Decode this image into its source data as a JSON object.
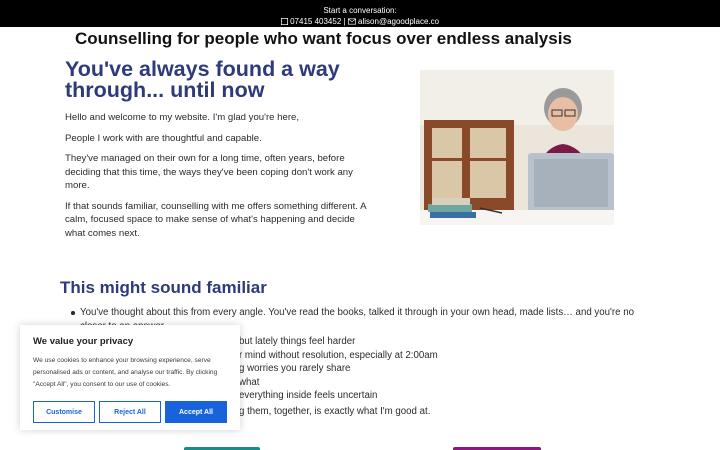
{
  "topbar": {
    "title": "Start a conversation:",
    "phone": "07415 403452",
    "separator": " | ",
    "email": "alison@agoodplace.co"
  },
  "tagline": "Counselling for people who want focus over endless analysis",
  "hero": {
    "title": "You've always found a way through... until now",
    "paragraphs": [
      "Hello and welcome to my website. I'm glad you're here,",
      "People I work with are thoughtful and capable.",
      "They've managed on their own for a long time, often years, before deciding that this time, the ways they've been coping don't work any more.",
      "If that sounds familiar, counselling with me offers something different. A calm, focused space to make sense of what's happening and decide what comes next."
    ]
  },
  "familiar": {
    "title": "This might sound familiar",
    "bullets": [
      "You've thought about this from every angle. You've read the books, talked it through in your own head, made lists… and you're no closer to an answer",
      "but lately things feel harder",
      "r mind without resolution, especially at 2:00am",
      "g worries you rarely share",
      "what",
      "everything inside feels uncertain"
    ],
    "closing": "g them, together, is exactly what I'm good at."
  },
  "cookie": {
    "title": "We value your privacy",
    "text": "We use cookies to enhance your browsing experience, serve personalised ads or content, and analyse our traffic. By clicking \"Accept All\", you consent to our use of cookies.",
    "customise": "Customise",
    "reject": "Reject All",
    "accept": "Accept All"
  },
  "colors": {
    "heading": "#2e3a7a",
    "accept_button": "#1863dc",
    "teal_button": "#1e8a86",
    "purple_button": "#8a1a7a"
  },
  "icons": {
    "phone": "phone-icon",
    "email": "envelope-icon"
  }
}
